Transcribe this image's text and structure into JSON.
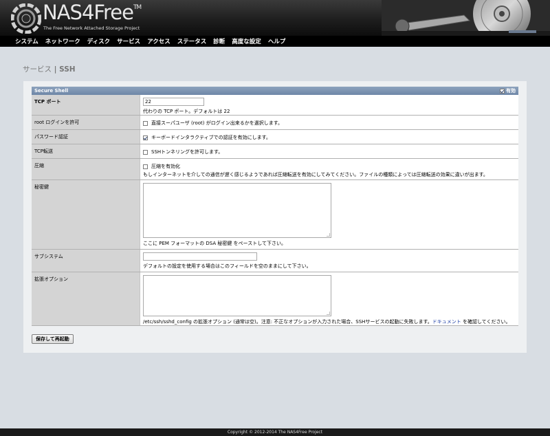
{
  "header": {
    "logo_text": "NAS4Free",
    "logo_tm": "TM",
    "subtitle": "The Free Network Attached Storage Project"
  },
  "nav": {
    "items": [
      "システム",
      "ネットワーク",
      "ディスク",
      "サービス",
      "アクセス",
      "ステータス",
      "診断",
      "高度な設定",
      "ヘルプ"
    ]
  },
  "page": {
    "title_prefix": "サービス",
    "title_sep": " | ",
    "title_name": "SSH"
  },
  "section": {
    "title": "Secure Shell",
    "enable_label": "有効",
    "enable_checked": true
  },
  "fields": {
    "tcp_port": {
      "label": "TCP ポート",
      "value": "22",
      "hint": "代わりの TCP ポート。デフォルトは 22"
    },
    "root_login": {
      "label": "root ログインを許可",
      "checkbox_label": "直接スーパユーザ (root) がログイン出来るかを選択します。",
      "checked": false
    },
    "password_auth": {
      "label": "パスワード認証",
      "checkbox_label": "キーボードインタラクティブでの認証を有効にします。",
      "checked": true
    },
    "tcp_forward": {
      "label": "TCP転送",
      "checkbox_label": "SSHトンネリングを許可します。",
      "checked": false
    },
    "compression": {
      "label": "圧縮",
      "checkbox_label": "圧縮を有効化",
      "checked": false,
      "hint": "もしインターネットを介しての通信が遅く感じるようであれば圧縮転送を有効にしてみてください。ファイルの種類によっては圧縮転送の効果に違いが出ます。"
    },
    "private_key": {
      "label": "秘密鍵",
      "value": "",
      "hint": "ここに PEM フォーマットの DSA 秘密鍵 をペーストして下さい。"
    },
    "subsystem": {
      "label": "サブシステム",
      "value": "",
      "hint": "デフォルトの設定を使用する場合はこのフィールドを空のままにして下さい。"
    },
    "extra_options": {
      "label": "拡張オプション",
      "value": "",
      "hint_before": "/etc/ssh/sshd_config の拡張オプション (通常は空)。注意: 不正なオプションが入力された場合、SSHサービスの起動に失敗します。",
      "hint_link": "ドキュメント",
      "hint_after": " を確認してください。"
    }
  },
  "actions": {
    "save_restart": "保存して再起動"
  },
  "footer": {
    "copyright": "Copyright © 2012-2014 The NAS4Free Project"
  },
  "colors": {
    "section_header": "#7890b0",
    "nav_bg": "#000000",
    "link": "#2243a8"
  }
}
